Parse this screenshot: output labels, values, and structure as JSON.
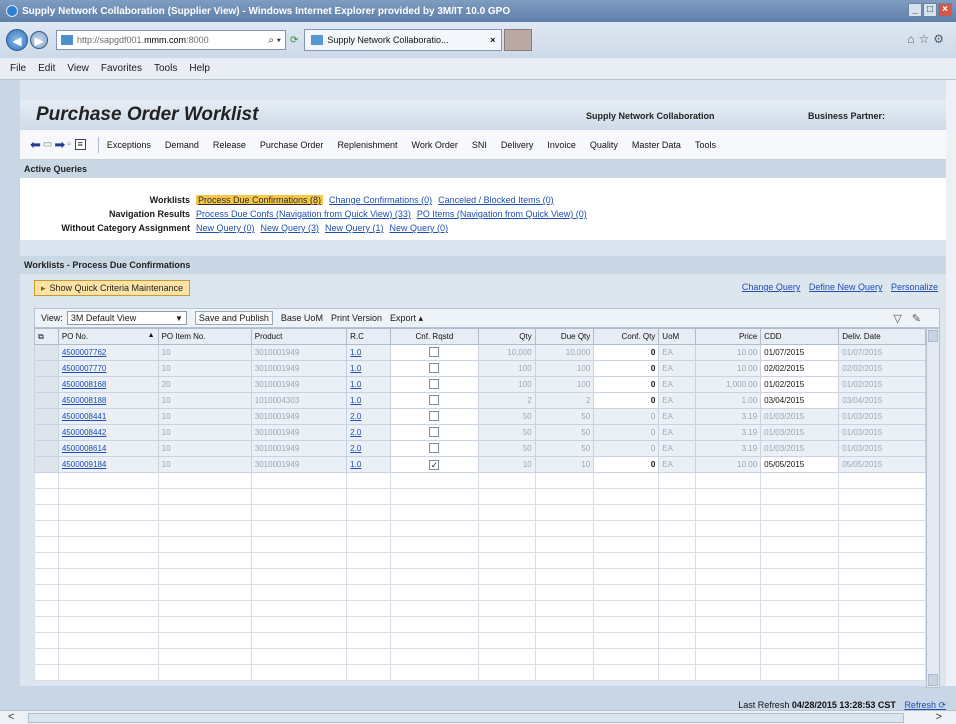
{
  "browser": {
    "title": "Supply Network Collaboration (Supplier View) - Windows Internet Explorer provided by 3M/IT 10.0 GPO",
    "address": {
      "prefix": "http://sapgdf001.",
      "host": "mmm.com",
      "suffix": ":8000"
    },
    "tab_label": "Supply Network Collaboratio...",
    "menu": [
      "File",
      "Edit",
      "View",
      "Favorites",
      "Tools",
      "Help"
    ]
  },
  "header": {
    "title": "Purchase Order Worklist",
    "app_name": "Supply Network Collaboration",
    "partner_label": "Business Partner:"
  },
  "nav": [
    "Exceptions",
    "Demand",
    "Release",
    "Purchase Order",
    "Replenishment",
    "Work Order",
    "SNI",
    "Delivery",
    "Invoice",
    "Quality",
    "Master Data",
    "Tools"
  ],
  "active_queries": {
    "heading": "Active Queries",
    "rows": [
      {
        "label": "Worklists",
        "links": [
          "Process Due Confirmations (8)",
          "Change Confirmations (0)",
          "Canceled / Blocked Items (0)"
        ]
      },
      {
        "label": "Navigation Results",
        "links": [
          "Process Due Confs (Navigation from Quick View) (33)",
          "PO Items (Navigation from Quick View) (0)"
        ]
      },
      {
        "label": "Without Category Assignment",
        "links": [
          "New Query (0)",
          "New Query (3)",
          "New Query (1)",
          "New Query (0)"
        ]
      }
    ]
  },
  "worklist": {
    "heading": "Worklists - Process Due Confirmations",
    "quick_criteria": "Show Quick Criteria Maintenance",
    "links": [
      "Change Query",
      "Define New Query",
      "Personalize"
    ],
    "toolbar": {
      "view_label": "View:",
      "view_value": "3M Default View",
      "save_publish": "Save and Publish",
      "base_uom": "Base UoM",
      "print_version": "Print Version",
      "export": "Export"
    },
    "columns": [
      "PO No.",
      "PO Item No.",
      "Product",
      "R.C",
      "Cnf. Rqstd",
      "Qty",
      "Due Qty",
      "Conf. Qty",
      "UoM",
      "Price",
      "CDD",
      "Deliv. Date"
    ],
    "rows": [
      {
        "po": "4500007762",
        "item": "10",
        "product": "3010001949",
        "rc": "1.0",
        "cnf": false,
        "qty": "10,000",
        "due": "10,000",
        "conf": "0",
        "uom": "EA",
        "price": "10.00",
        "cdd": "01/07/2015",
        "deliv": "01/07/2015",
        "conf_edit": true,
        "cdd_edit": true
      },
      {
        "po": "4500007770",
        "item": "10",
        "product": "3010001949",
        "rc": "1.0",
        "cnf": false,
        "qty": "100",
        "due": "100",
        "conf": "0",
        "uom": "EA",
        "price": "10.00",
        "cdd": "02/02/2015",
        "deliv": "02/02/2015",
        "conf_edit": true,
        "cdd_edit": true
      },
      {
        "po": "4500008168",
        "item": "20",
        "product": "3010001949",
        "rc": "1.0",
        "cnf": false,
        "qty": "100",
        "due": "100",
        "conf": "0",
        "uom": "EA",
        "price": "1,000.00",
        "cdd": "01/02/2015",
        "deliv": "01/02/2015",
        "conf_edit": true,
        "cdd_edit": true
      },
      {
        "po": "4500008188",
        "item": "10",
        "product": "1010004303",
        "rc": "1.0",
        "cnf": false,
        "qty": "2",
        "due": "2",
        "conf": "0",
        "uom": "EA",
        "price": "1.00",
        "cdd": "03/04/2015",
        "deliv": "03/04/2015",
        "conf_edit": true,
        "cdd_edit": true
      },
      {
        "po": "4500008441",
        "item": "10",
        "product": "3010001949",
        "rc": "2.0",
        "cnf": false,
        "qty": "50",
        "due": "50",
        "conf": "0",
        "uom": "EA",
        "price": "3.19",
        "cdd": "01/03/2015",
        "deliv": "01/03/2015",
        "conf_edit": false,
        "cdd_edit": false
      },
      {
        "po": "4500008442",
        "item": "10",
        "product": "3010001949",
        "rc": "2.0",
        "cnf": false,
        "qty": "50",
        "due": "50",
        "conf": "0",
        "uom": "EA",
        "price": "3.19",
        "cdd": "01/03/2015",
        "deliv": "01/03/2015",
        "conf_edit": false,
        "cdd_edit": false
      },
      {
        "po": "4500008614",
        "item": "10",
        "product": "3010001949",
        "rc": "2.0",
        "cnf": false,
        "qty": "50",
        "due": "50",
        "conf": "0",
        "uom": "EA",
        "price": "3.19",
        "cdd": "01/03/2015",
        "deliv": "01/03/2015",
        "conf_edit": false,
        "cdd_edit": false
      },
      {
        "po": "4500009184",
        "item": "10",
        "product": "3010001949",
        "rc": "1.0",
        "cnf": true,
        "qty": "10",
        "due": "10",
        "conf": "0",
        "uom": "EA",
        "price": "10.00",
        "cdd": "05/05/2015",
        "deliv": "05/05/2015",
        "conf_edit": true,
        "cdd_edit": true
      }
    ]
  },
  "footer": {
    "refresh_text": "Last Refresh",
    "refresh_time": "04/28/2015 13:28:53 CST",
    "refresh_link": "Refresh"
  },
  "colors": {
    "active_query": "#f6c84a",
    "link": "#1e4fb0",
    "header_band": "#cad7e5"
  }
}
